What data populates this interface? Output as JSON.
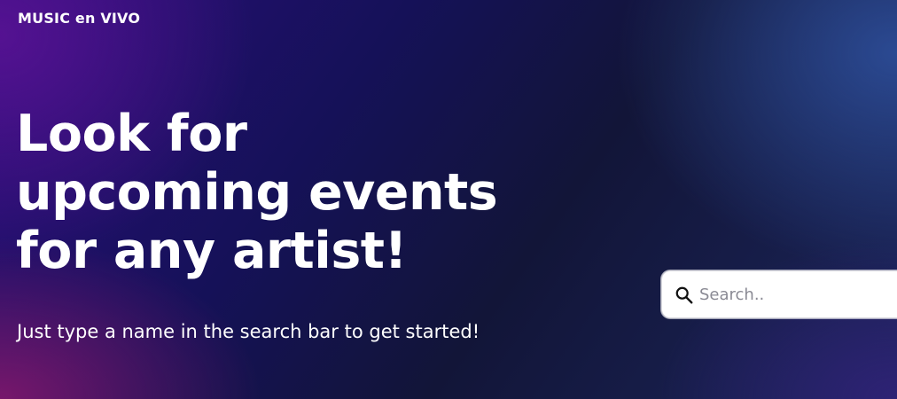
{
  "brand": {
    "title": "MUSIC en VIVO"
  },
  "hero": {
    "headline": "Look for upcoming events for any artist!",
    "subtitle": "Just type a name in the search bar to get started!"
  },
  "search": {
    "placeholder": "Search..",
    "value": "",
    "icon": "search-icon"
  },
  "colors": {
    "background_left": "#2a0f7a",
    "background_center": "#121538",
    "background_right": "#2c4c96",
    "accent_pink": "#96196e",
    "text": "#ffffff",
    "search_background": "#ffffff"
  }
}
